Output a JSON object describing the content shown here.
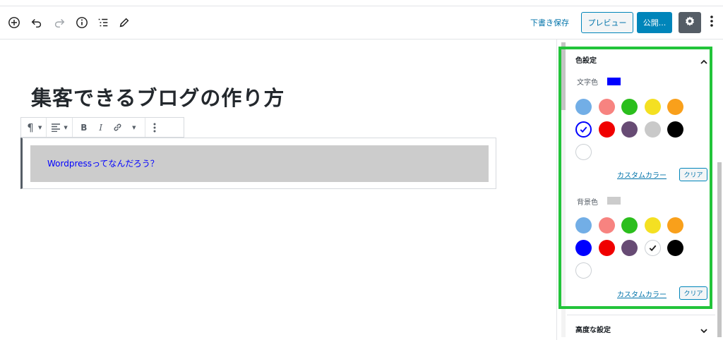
{
  "toolbar": {
    "save_draft": "下書き保存",
    "preview": "プレビュー",
    "publish": "公開..."
  },
  "post": {
    "title": "集客できるブログの作り方",
    "paragraph": "Wordpressってなんだろう？"
  },
  "block_toolbar": {
    "paragraph_symbol": "¶",
    "bold": "B",
    "italic": "I"
  },
  "sidebar": {
    "color_panel": {
      "title": "色設定",
      "text_color": {
        "label": "文字色",
        "current": "#0000ff",
        "palette": [
          "#72aee6",
          "#f78380",
          "#2bbe1d",
          "#f4e022",
          "#f9a01b",
          "#0000ff",
          "#f00000",
          "#674b74",
          "#c9c9c9",
          "#000000",
          "#ffffff"
        ],
        "selected_index": 5,
        "custom_link": "カスタムカラー",
        "clear": "クリア"
      },
      "background_color": {
        "label": "背景色",
        "current": "#cccccc",
        "palette": [
          "#72aee6",
          "#f78380",
          "#2bbe1d",
          "#f4e022",
          "#f9a01b",
          "#0000ff",
          "#f00000",
          "#674b74",
          "#ffffff",
          "#000000",
          "#ffffff"
        ],
        "selected_index": 8,
        "custom_link": "カスタムカラー",
        "clear": "クリア"
      }
    },
    "advanced_panel": {
      "title": "高度な設定"
    }
  },
  "colors": {
    "accent": "#0085ba",
    "highlight": "#22c43a"
  }
}
